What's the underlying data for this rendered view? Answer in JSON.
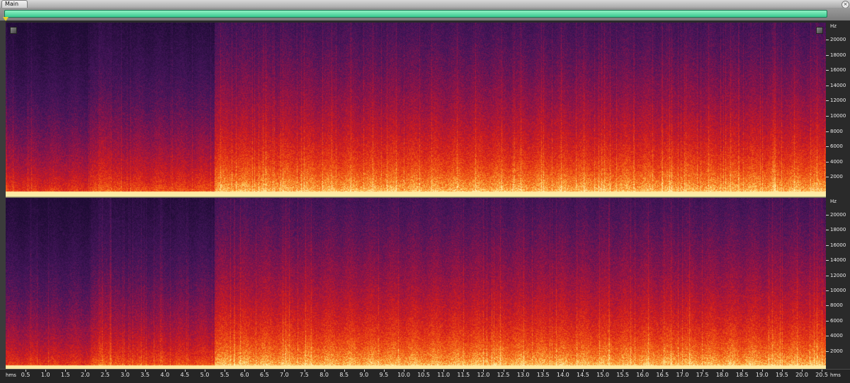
{
  "tab": {
    "label": "Main",
    "close_glyph": "×"
  },
  "freq_axis": {
    "unit": "Hz",
    "ticks": [
      "20000",
      "18000",
      "16000",
      "14000",
      "12000",
      "10000",
      "8000",
      "6000",
      "4000",
      "2000"
    ]
  },
  "time_axis": {
    "unit_left": "hms",
    "unit_right": "hms",
    "ticks": [
      "0.5",
      "1.0",
      "1.5",
      "2.0",
      "2.5",
      "3.0",
      "3.5",
      "4.0",
      "4.5",
      "5.0",
      "5.5",
      "6.0",
      "6.5",
      "7.0",
      "7.5",
      "8.0",
      "8.5",
      "9.0",
      "9.5",
      "10.0",
      "10.5",
      "11.0",
      "11.5",
      "12.0",
      "12.5",
      "13.0",
      "13.5",
      "14.0",
      "14.5",
      "15.0",
      "15.5",
      "16.0",
      "16.5",
      "17.0",
      "17.5",
      "18.0",
      "18.5",
      "19.0",
      "19.5",
      "20.0",
      "20.5"
    ]
  },
  "colors": {
    "scroll_thumb": "#3ac88f",
    "spectrogram_low": "#3a1a55",
    "spectrogram_mid": "#d21a1a",
    "spectrogram_high": "#ffe08a"
  }
}
